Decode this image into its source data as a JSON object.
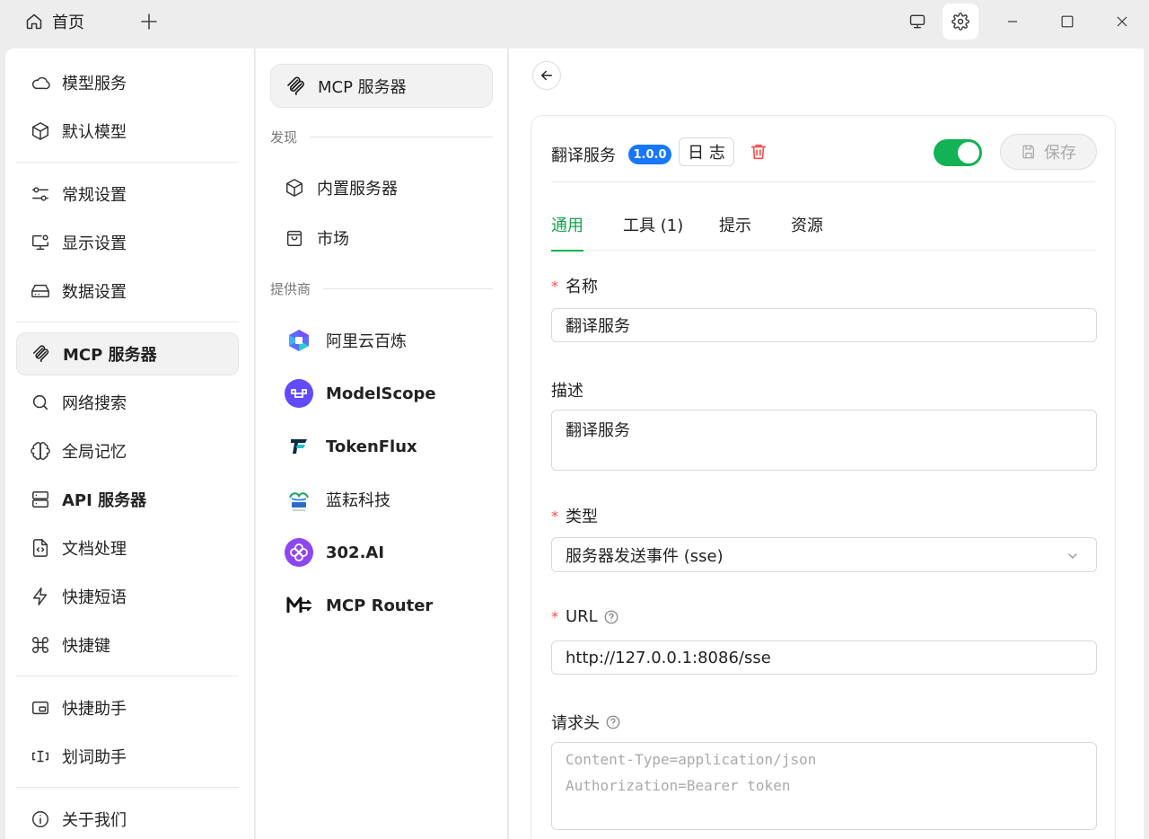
{
  "titlebar": {
    "home_tab": "首页",
    "icons": [
      "home-icon",
      "plus-icon",
      "monitor-icon",
      "gear-icon",
      "minimize-icon",
      "maximize-icon",
      "close-icon"
    ]
  },
  "sidebar": {
    "items": [
      {
        "label": "模型服务",
        "icon": "cloud-icon"
      },
      {
        "label": "默认模型",
        "icon": "cube-icon"
      },
      {
        "label": "常规设置",
        "icon": "sliders-icon"
      },
      {
        "label": "显示设置",
        "icon": "monitor-settings-icon"
      },
      {
        "label": "数据设置",
        "icon": "hard-drive-icon"
      },
      {
        "label": "MCP 服务器",
        "icon": "mcp-icon"
      },
      {
        "label": "网络搜索",
        "icon": "search-icon"
      },
      {
        "label": "全局记忆",
        "icon": "brain-icon"
      },
      {
        "label": "API 服务器",
        "icon": "server-icon"
      },
      {
        "label": "文档处理",
        "icon": "file-code-icon"
      },
      {
        "label": "快捷短语",
        "icon": "zap-icon"
      },
      {
        "label": "快捷键",
        "icon": "command-icon"
      },
      {
        "label": "快捷助手",
        "icon": "app-window-icon"
      },
      {
        "label": "划词助手",
        "icon": "text-cursor-icon"
      },
      {
        "label": "关于我们",
        "icon": "info-icon"
      }
    ]
  },
  "middle": {
    "top_label": "MCP 服务器",
    "discover_section": "发现",
    "discover_items": [
      {
        "label": "内置服务器",
        "icon": "cube-icon"
      },
      {
        "label": "市场",
        "icon": "shopping-bag-icon"
      }
    ],
    "provider_section": "提供商",
    "providers": [
      {
        "label": "阿里云百炼",
        "icon": "bailian-logo"
      },
      {
        "label": "ModelScope",
        "icon": "modelscope-logo"
      },
      {
        "label": "TokenFlux",
        "icon": "tokenflux-logo"
      },
      {
        "label": "蓝耘科技",
        "icon": "lanyun-logo"
      },
      {
        "label": "302.AI",
        "icon": "302ai-logo"
      },
      {
        "label": "MCP Router",
        "icon": "mcprouter-logo"
      }
    ]
  },
  "detail": {
    "service_name": "翻译服务",
    "version": "1.0.0",
    "log_button": "日 志",
    "save_button": "保存",
    "enabled": true,
    "tabs": [
      "通用",
      "工具 (1)",
      "提示",
      "资源"
    ],
    "active_tab": "通用",
    "form": {
      "name_label": "名称",
      "name_value": "翻译服务",
      "desc_label": "描述",
      "desc_value": "翻译服务",
      "type_label": "类型",
      "type_value": "服务器发送事件 (sse)",
      "url_label": "URL",
      "url_value": "http://127.0.0.1:8086/sse",
      "headers_label": "请求头",
      "headers_placeholder_1": "Content-Type=application/json",
      "headers_placeholder_2": "Authorization=Bearer token"
    }
  },
  "colors": {
    "accent_green": "#13b255",
    "badge_blue": "#1677ff",
    "required_red": "#ff4d4f",
    "delete_red": "#ff4d4f"
  }
}
